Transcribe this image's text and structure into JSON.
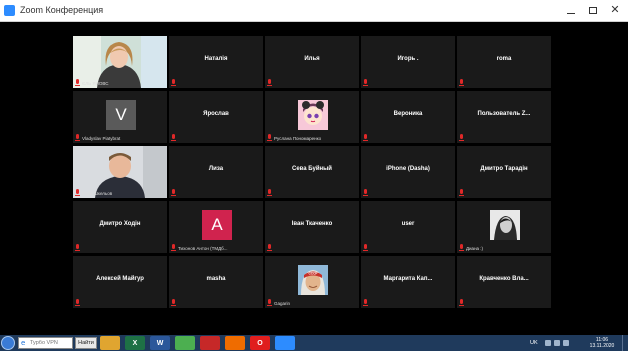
{
  "window": {
    "title": "Zoom Конференция"
  },
  "participants": [
    {
      "name": "",
      "label": "ЄЛЬ ЯНОВС",
      "type": "video-woman"
    },
    {
      "name": "Наталія",
      "label": "",
      "type": "name"
    },
    {
      "name": "Илья",
      "label": "",
      "type": "name"
    },
    {
      "name": "Игорь .",
      "label": "",
      "type": "name"
    },
    {
      "name": "roma",
      "label": "",
      "type": "name"
    },
    {
      "name": "",
      "label": "Vladyslav Piatybrat",
      "type": "avatar",
      "letter": "V",
      "color": "#5a5a5a"
    },
    {
      "name": "Ярослав",
      "label": "",
      "type": "name"
    },
    {
      "name": "",
      "label": "Руслана Пономаренко",
      "type": "avatar-anime"
    },
    {
      "name": "Вероника",
      "label": "",
      "type": "name"
    },
    {
      "name": "Пользователь  Z...",
      "label": "",
      "type": "name"
    },
    {
      "name": "",
      "label": "Юрій Шкельов",
      "type": "video-man",
      "active": true
    },
    {
      "name": "Лиза",
      "label": "",
      "type": "name"
    },
    {
      "name": "Сева Буйный",
      "label": "",
      "type": "name"
    },
    {
      "name": "iPhone (Dasha)",
      "label": "",
      "type": "name"
    },
    {
      "name": "Дмитро Тарадін",
      "label": "",
      "type": "name"
    },
    {
      "name": "Дмитро Ходін",
      "label": "",
      "type": "name"
    },
    {
      "name": "",
      "label": "Тихонов Антон (ТМДб...",
      "type": "avatar",
      "letter": "A",
      "color": "#d0234e"
    },
    {
      "name": "Іван Ткаченко",
      "label": "",
      "type": "name"
    },
    {
      "name": "user",
      "label": "",
      "type": "name"
    },
    {
      "name": "",
      "label": "Диана :)",
      "type": "avatar-bw"
    },
    {
      "name": "Алексей Майгур",
      "label": "",
      "type": "name"
    },
    {
      "name": "masha",
      "label": "",
      "type": "name"
    },
    {
      "name": "",
      "label": "Gagarin",
      "type": "avatar-gagarin"
    },
    {
      "name": "Маргарита  Кап...",
      "label": "",
      "type": "name"
    },
    {
      "name": "Кравченко  Вла...",
      "label": "",
      "type": "name"
    }
  ],
  "taskbar": {
    "search_placeholder": "Турбо VPN",
    "search_button": "Найти",
    "apps": [
      {
        "icon": "folder-icon",
        "color": "#e0a530",
        "glyph": ""
      },
      {
        "icon": "excel-icon",
        "color": "#1e7145",
        "glyph": "X"
      },
      {
        "icon": "word-icon",
        "color": "#2b579a",
        "glyph": "W"
      },
      {
        "icon": "chrome-icon",
        "color": "#4caf50",
        "glyph": ""
      },
      {
        "icon": "pdf-icon",
        "color": "#c62828",
        "glyph": ""
      },
      {
        "icon": "firefox-icon",
        "color": "#ef6c00",
        "glyph": ""
      },
      {
        "icon": "opera-icon",
        "color": "#e01e1e",
        "glyph": "O"
      },
      {
        "icon": "zoom-icon",
        "color": "#2d8cff",
        "glyph": ""
      }
    ],
    "lang": "UK",
    "time": "11:06",
    "date": "13.11.2020"
  }
}
